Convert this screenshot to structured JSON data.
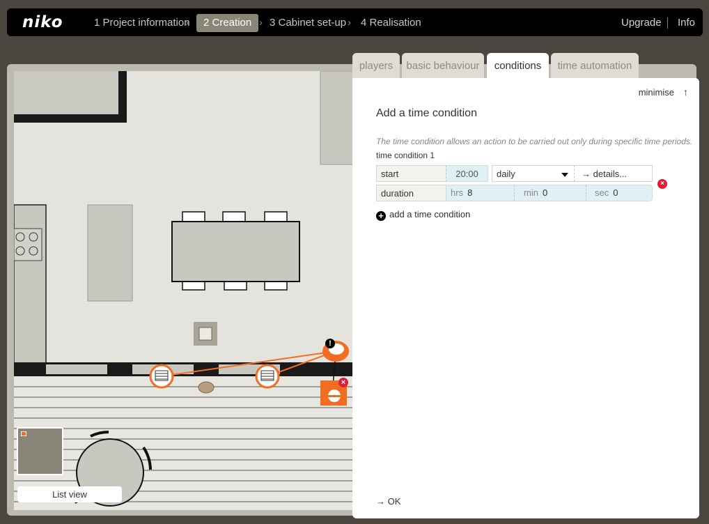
{
  "brand": "niko",
  "steps": [
    {
      "label": "1 Project information",
      "active": false
    },
    {
      "label": "2 Creation",
      "active": true
    },
    {
      "label": "3 Cabinet set-up",
      "active": false
    },
    {
      "label": "4 Realisation",
      "active": false
    }
  ],
  "topright": {
    "upgrade": "Upgrade",
    "info": "Info"
  },
  "tabs": [
    {
      "label": "players",
      "active": false
    },
    {
      "label": "basic behaviour",
      "active": false
    },
    {
      "label": "conditions",
      "active": true
    },
    {
      "label": "time automation",
      "active": false
    }
  ],
  "panel": {
    "minimise_label": "minimise",
    "title": "Add a time condition",
    "description": "The time condition allows an action to be carried out only during specific time periods.",
    "condition_name": "time condition 1",
    "start": {
      "label": "start",
      "time": "20:00",
      "recurrence": "daily",
      "details_label": "details..."
    },
    "duration": {
      "label": "duration",
      "hrs_label": "hrs",
      "hrs": "8",
      "min_label": "min",
      "min": "0",
      "sec_label": "sec",
      "sec": "0"
    },
    "add_label": "add a time condition",
    "ok_label": "OK"
  },
  "plan": {
    "list_view_label": "List view",
    "warning_glyph": "!",
    "remove_glyph": "×"
  },
  "colors": {
    "accent": "#f26d21",
    "active_step": "#8a8677",
    "danger": "#e11d35",
    "input_blue": "#e1f0f5"
  },
  "icons": [
    "arrow-up-icon",
    "arrow-right-icon",
    "chevron-right-icon",
    "chevron-down-icon",
    "remove-icon",
    "add-icon",
    "blinds-icon",
    "speech-bubble-icon",
    "motion-sensor-icon",
    "warning-icon"
  ]
}
